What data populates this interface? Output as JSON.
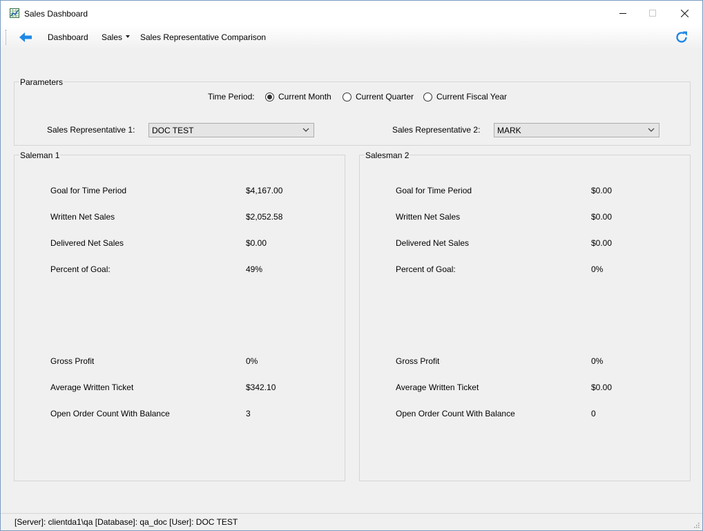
{
  "window": {
    "title": "Sales Dashboard",
    "icon": "chart-window-icon",
    "controls": [
      "minimize-icon",
      "maximize-icon",
      "close-icon"
    ]
  },
  "toolbar": {
    "back_icon": "arrow-left-icon",
    "dashboard_label": "Dashboard",
    "sales_label": "Sales",
    "breadcrumb_label": "Sales Representative Comparison",
    "refresh_icon": "refresh-icon",
    "accent_color": "#1e88e5"
  },
  "parameters": {
    "legend": "Parameters",
    "time_period_label": "Time Period:",
    "options": [
      {
        "label": "Current Month",
        "selected": true
      },
      {
        "label": "Current Quarter",
        "selected": false
      },
      {
        "label": "Current Fiscal Year",
        "selected": false
      }
    ],
    "rep1_label": "Sales Representative 1:",
    "rep1_value": "DOC TEST",
    "rep2_label": "Sales Representative 2:",
    "rep2_value": "MARK"
  },
  "panels": [
    {
      "legend": "Saleman 1",
      "rows": [
        {
          "label": "Goal for Time Period",
          "value": "$4,167.00"
        },
        {
          "label": "Written Net Sales",
          "value": "$2,052.58"
        },
        {
          "label": "Delivered Net Sales",
          "value": "$0.00"
        },
        {
          "label": "Percent of Goal:",
          "value": "49%"
        },
        {
          "label": "Gross Profit",
          "value": "0%"
        },
        {
          "label": "Average Written Ticket",
          "value": "$342.10"
        },
        {
          "label": "Open Order Count With Balance",
          "value": "3"
        }
      ]
    },
    {
      "legend": "Salesman 2",
      "rows": [
        {
          "label": "Goal for Time Period",
          "value": "$0.00"
        },
        {
          "label": "Written Net Sales",
          "value": "$0.00"
        },
        {
          "label": "Delivered Net Sales",
          "value": "$0.00"
        },
        {
          "label": "Percent of Goal:",
          "value": "0%"
        },
        {
          "label": "Gross Profit",
          "value": "0%"
        },
        {
          "label": "Average Written Ticket",
          "value": "$0.00"
        },
        {
          "label": "Open Order Count With Balance",
          "value": "0"
        }
      ]
    }
  ],
  "statusbar": {
    "text": "[Server]: clientda1\\qa  [Database]: qa_doc  [User]: DOC TEST"
  }
}
